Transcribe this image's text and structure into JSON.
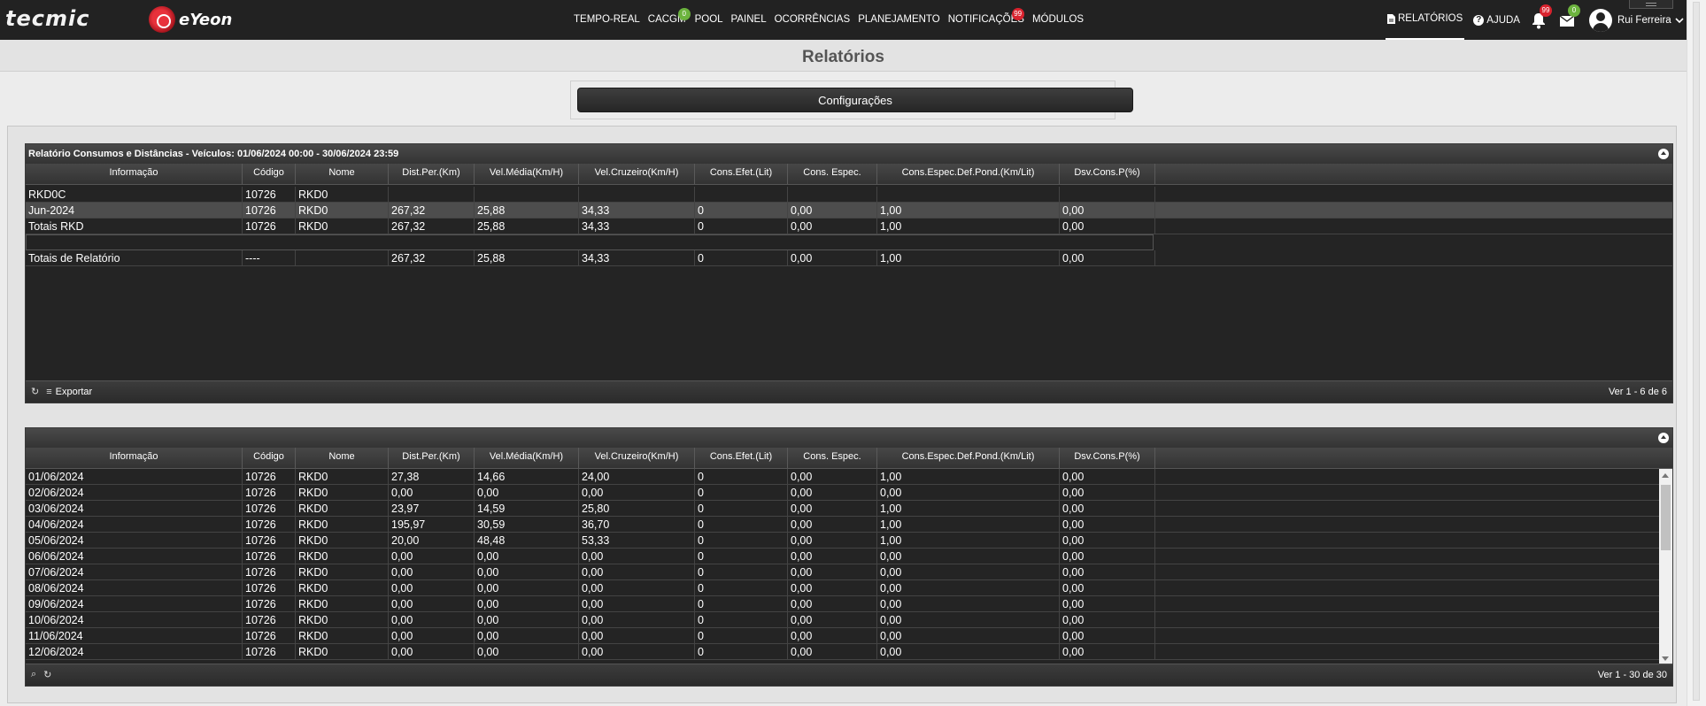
{
  "brand": {
    "logo1": "tecmic",
    "logo2": "eYeon"
  },
  "nav": {
    "items": [
      {
        "label": "TEMPO-REAL"
      },
      {
        "label": "CACGM",
        "badge": "0",
        "badge_color": "#6cb33e"
      },
      {
        "label": "POOL"
      },
      {
        "label": "PAINEL"
      },
      {
        "label": "OCORRÊNCIAS"
      },
      {
        "label": "PLANEJAMENTO"
      },
      {
        "label": "NOTIFICAÇÕES",
        "badge": "99",
        "badge_color": "#d9232e"
      },
      {
        "label": "MÓDULOS"
      }
    ],
    "reports": "RELATÓRIOS",
    "help": "AJUDA",
    "bell_badge": "99",
    "mail_badge": "0",
    "user": "Rui Ferreira"
  },
  "page": {
    "title": "Relatórios",
    "config_button": "Configurações"
  },
  "columns": [
    "Informação",
    "Código",
    "Nome",
    "Dist.Per.(Km)",
    "Vel.Média(Km/H)",
    "Vel.Cruzeiro(Km/H)",
    "Cons.Efet.(Lit)",
    "Cons. Espec.",
    "Cons.Espec.Def.Pond.(Km/Lit)",
    "Dsv.Cons.P(%)"
  ],
  "report1": {
    "title": "Relatório Consumos e Distâncias - Veículos: 01/06/2024 00:00 - 30/06/2024 23:59",
    "rows": [
      [
        "RKD0C",
        "10726",
        "RKD0",
        "",
        "",
        "",
        "",
        "",
        "",
        ""
      ],
      [
        "Jun-2024",
        "10726",
        "RKD0",
        "267,32",
        "25,88",
        "34,33",
        "0",
        "0,00",
        "1,00",
        "0,00"
      ],
      [
        "Totais RKD",
        "10726",
        "RKD0",
        "267,32",
        "25,88",
        "34,33",
        "0",
        "0,00",
        "1,00",
        "0,00"
      ],
      [],
      [
        "Totais de Relatório",
        "----",
        "",
        "267,32",
        "25,88",
        "34,33",
        "0",
        "0,00",
        "1,00",
        "0,00"
      ]
    ],
    "export_label": "Exportar",
    "footer": "Ver 1 - 6 de 6"
  },
  "report2": {
    "rows": [
      [
        "01/06/2024",
        "10726",
        "RKD0",
        "27,38",
        "14,66",
        "24,00",
        "0",
        "0,00",
        "1,00",
        "0,00"
      ],
      [
        "02/06/2024",
        "10726",
        "RKD0",
        "0,00",
        "0,00",
        "0,00",
        "0",
        "0,00",
        "0,00",
        "0,00"
      ],
      [
        "03/06/2024",
        "10726",
        "RKD0",
        "23,97",
        "14,59",
        "25,80",
        "0",
        "0,00",
        "1,00",
        "0,00"
      ],
      [
        "04/06/2024",
        "10726",
        "RKD0",
        "195,97",
        "30,59",
        "36,70",
        "0",
        "0,00",
        "1,00",
        "0,00"
      ],
      [
        "05/06/2024",
        "10726",
        "RKD0",
        "20,00",
        "48,48",
        "53,33",
        "0",
        "0,00",
        "1,00",
        "0,00"
      ],
      [
        "06/06/2024",
        "10726",
        "RKD0",
        "0,00",
        "0,00",
        "0,00",
        "0",
        "0,00",
        "0,00",
        "0,00"
      ],
      [
        "07/06/2024",
        "10726",
        "RKD0",
        "0,00",
        "0,00",
        "0,00",
        "0",
        "0,00",
        "0,00",
        "0,00"
      ],
      [
        "08/06/2024",
        "10726",
        "RKD0",
        "0,00",
        "0,00",
        "0,00",
        "0",
        "0,00",
        "0,00",
        "0,00"
      ],
      [
        "09/06/2024",
        "10726",
        "RKD0",
        "0,00",
        "0,00",
        "0,00",
        "0",
        "0,00",
        "0,00",
        "0,00"
      ],
      [
        "10/06/2024",
        "10726",
        "RKD0",
        "0,00",
        "0,00",
        "0,00",
        "0",
        "0,00",
        "0,00",
        "0,00"
      ],
      [
        "11/06/2024",
        "10726",
        "RKD0",
        "0,00",
        "0,00",
        "0,00",
        "0",
        "0,00",
        "0,00",
        "0,00"
      ],
      [
        "12/06/2024",
        "10726",
        "RKD0",
        "0,00",
        "0,00",
        "0,00",
        "0",
        "0,00",
        "0,00",
        "0,00"
      ]
    ],
    "footer": "Ver 1 - 30 de 30"
  }
}
